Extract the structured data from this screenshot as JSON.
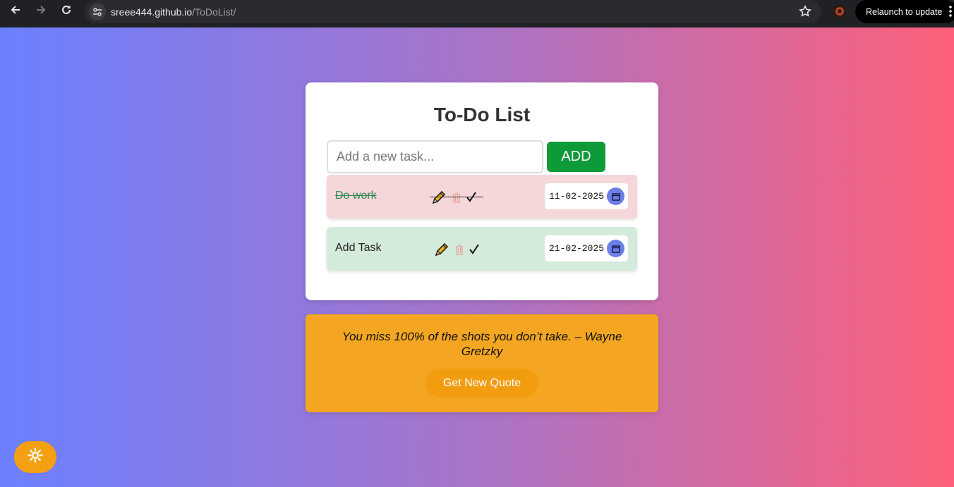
{
  "browser": {
    "url_host": "sreee444.github.io",
    "url_path": "/ToDoList/",
    "relaunch_label": "Relaunch to update"
  },
  "todo": {
    "title": "To-Do List",
    "input_placeholder": "Add a new task...",
    "add_label": "ADD",
    "tasks": [
      {
        "text": "Do work",
        "date": "11-02-2025",
        "completed": true,
        "icons": [
          "pencil-icon",
          "trash-icon",
          "check-icon"
        ]
      },
      {
        "text": "Add Task",
        "date": "21-02-2025",
        "completed": false,
        "icons": [
          "pencil-icon",
          "trash-icon",
          "check-icon"
        ]
      }
    ]
  },
  "quote": {
    "text": "You miss 100% of the shots you don’t take. – Wayne Gretzky",
    "button_label": "Get New Quote"
  },
  "theme_toggle": {
    "icon": "sun-icon"
  },
  "colors": {
    "add_button": "#0f9a3a",
    "completed_task_bg": "#f5d6d9",
    "open_task_bg": "#d4eadb",
    "quote_bg": "#f4a623",
    "gradient_start": "#6b80ff",
    "gradient_end": "#fd6079"
  }
}
